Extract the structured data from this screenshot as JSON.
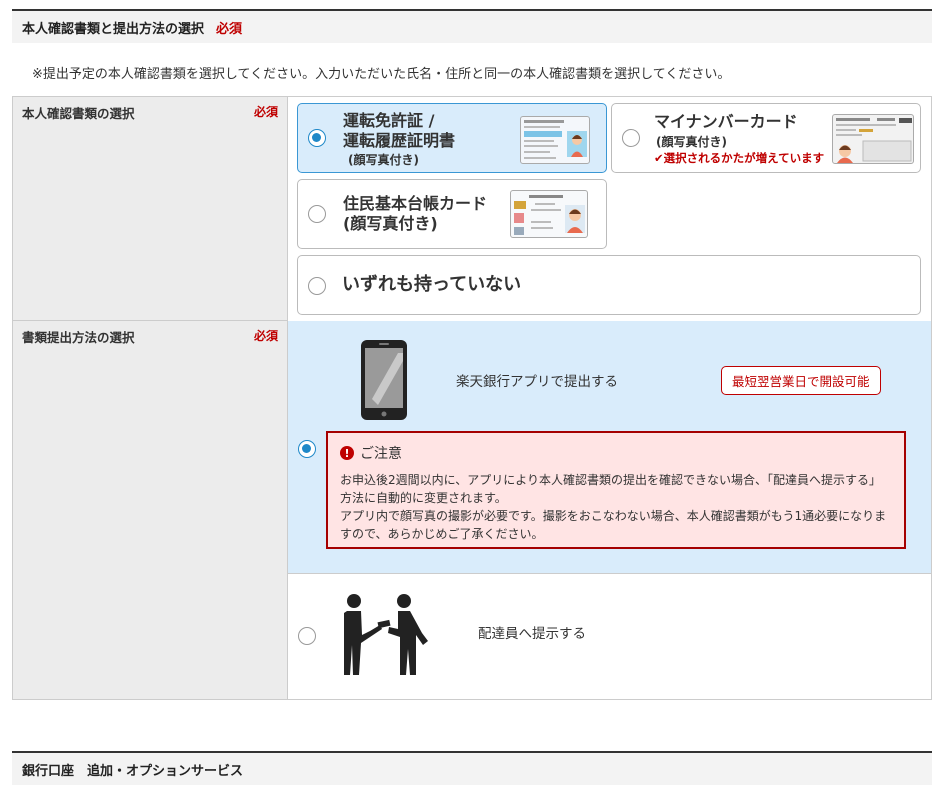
{
  "section1": {
    "title": "本人確認書類と提出方法の選択",
    "required": "必須"
  },
  "note": "※提出予定の本人確認書類を選択してください。入力いただいた氏名・住所と同一の本人確認書類を選択してください。",
  "id_doc": {
    "label": "本人確認書類の選択",
    "required": "必須",
    "options": [
      {
        "title_line1": "運転免許証 /",
        "title_line2": "運転履歴証明書",
        "sub": "(顔写真付き)",
        "selected": true
      },
      {
        "title": "マイナンバーカード",
        "sub": "(顔写真付き)",
        "flag": "選択されるかたが増えています",
        "selected": false
      },
      {
        "title_line1": "住民基本台帳カード",
        "title_line2": "(顔写真付き)",
        "selected": false
      },
      {
        "title": "いずれも持っていない",
        "selected": false
      }
    ]
  },
  "submit_method": {
    "label": "書類提出方法の選択",
    "required": "必須",
    "app": {
      "title": "楽天銀行アプリで提出する",
      "badge": "最短翌営業日で開設可能",
      "selected": true,
      "caution_title": "ご注意",
      "caution_line1": "お申込後2週間以内に、アプリにより本人確認書類の提出を確認できない場合、「配達員へ提示する」",
      "caution_line2": "方法に自動的に変更されます。",
      "caution_line3": "アプリ内で顔写真の撮影が必要です。撮影をおこなわない場合、本人確認書類がもう1通必要になりま",
      "caution_line4": "すので、あらかじめご了承ください。"
    },
    "courier": {
      "title": "配達員へ提示する",
      "selected": false
    }
  },
  "section2": {
    "title": "銀行口座　追加・オプションサービス"
  },
  "colors": {
    "accent": "#bf0000",
    "selected_bg": "#d9ecfb",
    "radio": "#1e88c8"
  }
}
